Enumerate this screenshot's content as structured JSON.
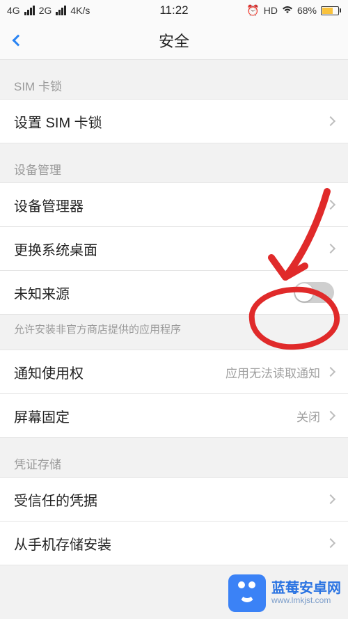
{
  "status": {
    "net1": "4G",
    "net2": "2G",
    "speed": "4K/s",
    "time": "11:22",
    "hd": "HD",
    "battery_pct": "68%"
  },
  "header": {
    "title": "安全"
  },
  "sections": {
    "sim": {
      "header": "SIM 卡锁",
      "set_sim": "设置 SIM 卡锁"
    },
    "device": {
      "header": "设备管理",
      "admin": "设备管理器",
      "launcher": "更换系统桌面",
      "unknown": "未知来源",
      "unknown_note": "允许安装非官方商店提供的应用程序"
    },
    "notif": {
      "notif_access": "通知使用权",
      "notif_value": "应用无法读取通知",
      "pin": "屏幕固定",
      "pin_value": "关闭"
    },
    "cred": {
      "header": "凭证存储",
      "trusted": "受信任的凭据",
      "install": "从手机存储安装"
    }
  },
  "watermark": {
    "line1": "蓝莓安卓网",
    "line2": "www.lmkjst.com"
  }
}
